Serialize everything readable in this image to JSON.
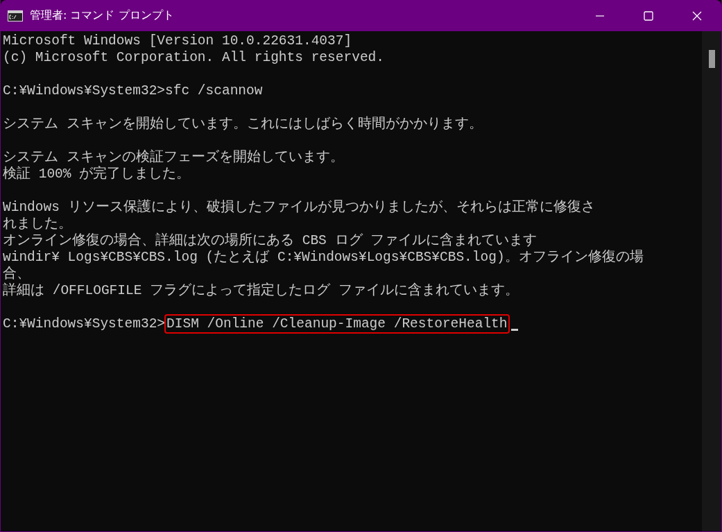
{
  "window": {
    "title": "管理者: コマンド プロンプト"
  },
  "console": {
    "blocks": [
      {
        "lines": [
          "Microsoft Windows [Version 10.0.22631.4037]",
          "(c) Microsoft Corporation. All rights reserved."
        ]
      },
      {
        "lines": [
          "C:¥Windows¥System32>sfc /scannow"
        ]
      },
      {
        "lines": [
          "システム スキャンを開始しています。これにはしばらく時間がかかります。"
        ]
      },
      {
        "lines": [
          "システム スキャンの検証フェーズを開始しています。",
          "検証 100% が完了しました。"
        ]
      },
      {
        "lines": [
          "Windows リソース保護により、破損したファイルが見つかりましたが、それらは正常に修復さ",
          "れました。",
          "オンライン修復の場合、詳細は次の場所にある CBS ログ ファイルに含まれています",
          "windir¥ Logs¥CBS¥CBS.log (たとえば C:¥Windows¥Logs¥CBS¥CBS.log)。オフライン修復の場",
          "合、",
          "詳細は /OFFLOGFILE フラグによって指定したログ ファイルに含まれています。"
        ]
      }
    ],
    "prompt": {
      "path": "C:¥Windows¥System32>",
      "command": "DISM /Online /Cleanup-Image /RestoreHealth",
      "highlighted": true
    }
  }
}
